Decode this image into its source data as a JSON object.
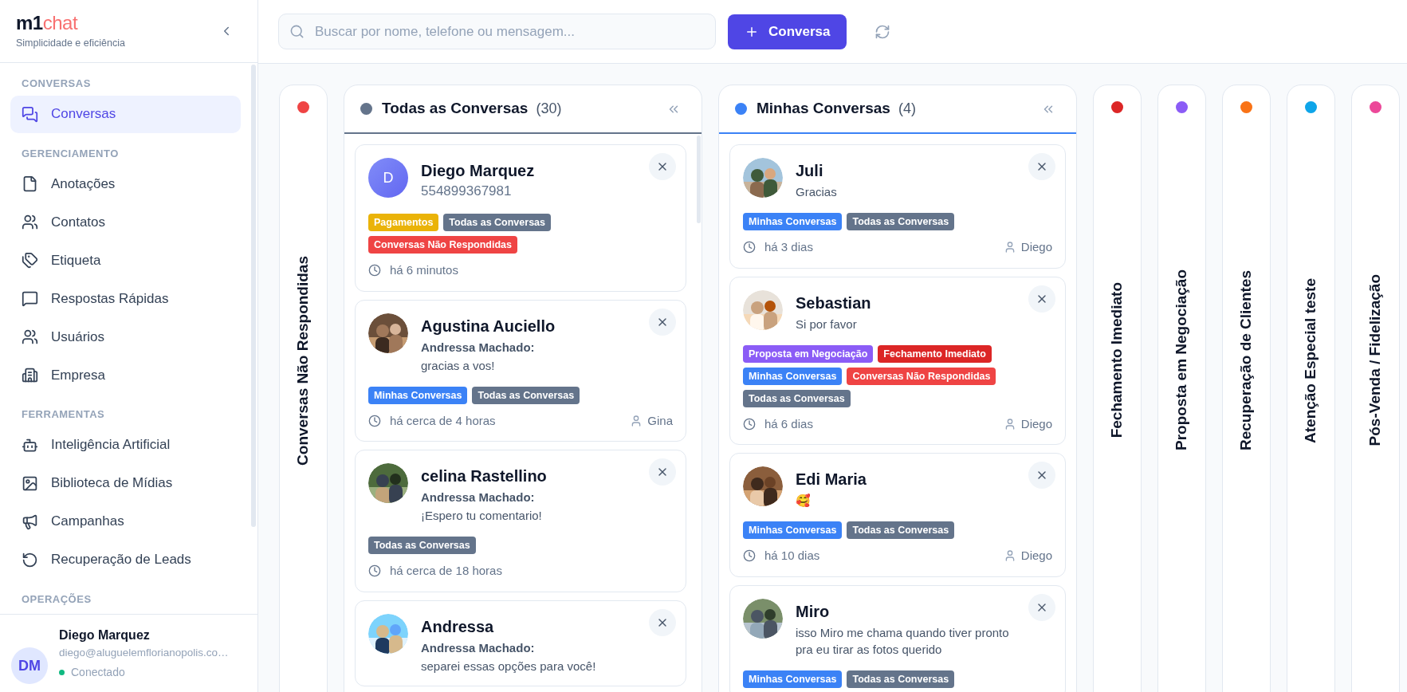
{
  "sidebar": {
    "logo": {
      "part_1": "m1",
      "part_2": "chat"
    },
    "tagline": "Simplicidade e eficiência",
    "sections": [
      {
        "heading": "CONVERSAS",
        "items": [
          {
            "label": "Conversas",
            "selected": true
          }
        ]
      },
      {
        "heading": "GERENCIAMENTO",
        "items": [
          {
            "label": "Anotações",
            "selected": false
          },
          {
            "label": "Contatos",
            "selected": false
          },
          {
            "label": "Etiqueta",
            "selected": false
          },
          {
            "label": "Respostas Rápidas",
            "selected": false
          },
          {
            "label": "Usuários",
            "selected": false
          },
          {
            "label": "Empresa",
            "selected": false
          }
        ]
      },
      {
        "heading": "FERRAMENTAS",
        "items": [
          {
            "label": "Inteligência Artificial",
            "selected": false
          },
          {
            "label": "Biblioteca de Mídias",
            "selected": false
          },
          {
            "label": "Campanhas",
            "selected": false
          },
          {
            "label": "Recuperação de Leads",
            "selected": false
          }
        ]
      },
      {
        "heading": "OPERAÇÕES"
      }
    ],
    "user": {
      "initials": "DM",
      "name": "Diego Marquez",
      "email": "diego@aluguelemflorianopolis.co…",
      "status": "Conectado",
      "online": true
    }
  },
  "toolbar": {
    "search": {
      "placeholder": "Buscar por nome, telefone ou mensagem..."
    },
    "new_button": "Conversa"
  },
  "columns": [
    {
      "kind": "collapsed",
      "title": "Conversas Não Respondidas",
      "color": "#ef4444"
    },
    {
      "kind": "expanded",
      "title": "Todas as Conversas",
      "count": "(30)",
      "color": "#64748b",
      "scrollbar": true,
      "cards": [
        {
          "avatar": {
            "kind": "letter",
            "letter": "D"
          },
          "name": "Diego Marquez",
          "phone": "554899367981",
          "tags": [
            {
              "label": "Pagamentos",
              "color": "#eab308"
            },
            {
              "label": "Todas as Conversas",
              "color": "#64748b"
            },
            {
              "label": "Conversas Não Respondidas",
              "color": "#ef4444"
            }
          ],
          "time": "há 6 minutos"
        },
        {
          "avatar": {
            "kind": "picture"
          },
          "name": "Agustina Auciello",
          "sender": "Andressa Machado:",
          "message": "gracias a vos!",
          "tags": [
            {
              "label": "Minhas Conversas",
              "color": "#3b82f6"
            },
            {
              "label": "Todas as Conversas",
              "color": "#64748b"
            }
          ],
          "time": "há cerca de 4 horas",
          "agent": "Gina"
        },
        {
          "avatar": {
            "kind": "picture"
          },
          "name": "celina Rastellino",
          "sender": "Andressa Machado:",
          "message": "¡Espero tu comentario!",
          "tags": [
            {
              "label": "Todas as Conversas",
              "color": "#64748b"
            }
          ],
          "time": "há cerca de 18 horas"
        },
        {
          "avatar": {
            "kind": "picture"
          },
          "name": "Andressa",
          "sender": "Andressa Machado:",
          "message": "separei essas opções para você!"
        }
      ]
    },
    {
      "kind": "expanded",
      "title": "Minhas Conversas",
      "count": "(4)",
      "color": "#3b82f6",
      "scrollbar": false,
      "cards": [
        {
          "avatar": {
            "kind": "picture"
          },
          "name": "Juli",
          "message": "Gracias",
          "tags": [
            {
              "label": "Minhas Conversas",
              "color": "#3b82f6"
            },
            {
              "label": "Todas as Conversas",
              "color": "#64748b"
            }
          ],
          "time": "há 3 dias",
          "agent": "Diego"
        },
        {
          "avatar": {
            "kind": "picture"
          },
          "name": "Sebastian",
          "message": "Si por favor",
          "tags": [
            {
              "label": "Proposta em Negociação",
              "color": "#8b5cf6"
            },
            {
              "label": "Fechamento Imediato",
              "color": "#dc2626"
            },
            {
              "label": "Minhas Conversas",
              "color": "#3b82f6"
            },
            {
              "label": "Conversas Não Respondidas",
              "color": "#ef4444"
            },
            {
              "label": "Todas as Conversas",
              "color": "#64748b"
            }
          ],
          "time": "há 6 dias",
          "agent": "Diego"
        },
        {
          "avatar": {
            "kind": "picture"
          },
          "name": "Edi Maria",
          "message": "🥰",
          "tags": [
            {
              "label": "Minhas Conversas",
              "color": "#3b82f6"
            },
            {
              "label": "Todas as Conversas",
              "color": "#64748b"
            }
          ],
          "time": "há 10 dias",
          "agent": "Diego"
        },
        {
          "avatar": {
            "kind": "picture"
          },
          "name": "Miro",
          "message": "isso Miro me chama quando tiver pronto pra eu tirar as fotos querido",
          "tags": [
            {
              "label": "Minhas Conversas",
              "color": "#3b82f6"
            },
            {
              "label": "Todas as Conversas",
              "color": "#64748b"
            }
          ]
        }
      ]
    },
    {
      "kind": "collapsed",
      "title": "Fechamento Imediato",
      "color": "#dc2626"
    },
    {
      "kind": "collapsed",
      "title": "Proposta em Negociação",
      "color": "#8b5cf6"
    },
    {
      "kind": "collapsed",
      "title": "Recuperação de Clientes",
      "color": "#f97316"
    },
    {
      "kind": "collapsed",
      "title": "Atenção Especial teste",
      "color": "#0ea5e9"
    },
    {
      "kind": "collapsed",
      "title": "Pós-Venda / Fidelização",
      "color": "#ec4899"
    }
  ]
}
